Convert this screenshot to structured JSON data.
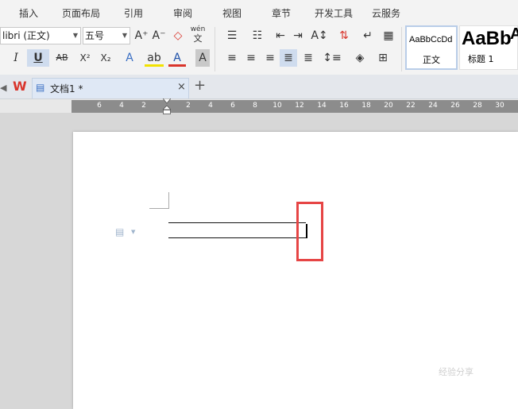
{
  "menu": {
    "items": [
      "插入",
      "页面布局",
      "引用",
      "审阅",
      "视图",
      "章节",
      "开发工具",
      "云服务"
    ]
  },
  "ribbon": {
    "font_name": "libri (正文)",
    "font_size": "五号",
    "grow_font": "A⁺",
    "shrink_font": "A⁻",
    "phonetic_label": "wén",
    "phonetic_char": "文",
    "italic": "I",
    "underline": "U",
    "strike": "AB",
    "superscript": "X²",
    "subscript": "X₂",
    "styles": {
      "normal_preview": "AaBbCcDd",
      "normal_label": "正文",
      "heading1_preview": "AaBb",
      "heading1_label": "标题 1",
      "heading2_preview": "A"
    }
  },
  "tabs": {
    "doc_title": "文档1 *",
    "close": "×",
    "new": "+"
  },
  "ruler": {
    "ticks": [
      "6",
      "4",
      "2",
      "2",
      "4",
      "6",
      "8",
      "10",
      "12",
      "14",
      "16",
      "18",
      "20",
      "22",
      "24",
      "26",
      "28",
      "30"
    ]
  },
  "colors": {
    "highlight_box": "#e64545",
    "wps_logo": "#d9342b",
    "tab_active": "#dfe8f5"
  },
  "watermark": "经验分享"
}
